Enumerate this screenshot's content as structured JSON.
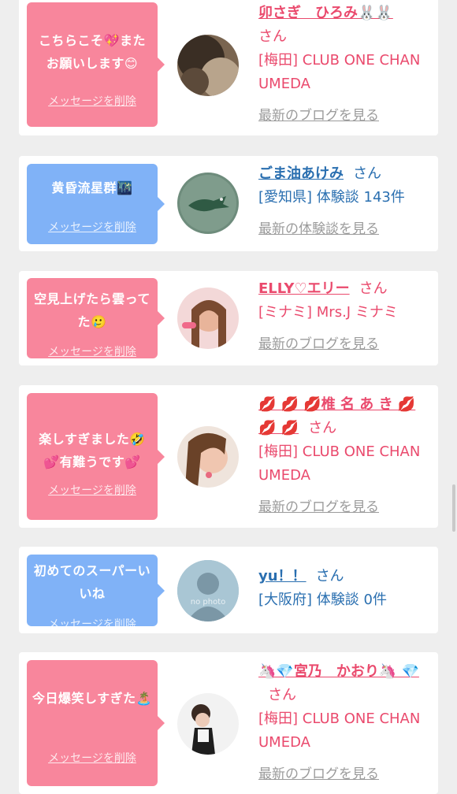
{
  "delete_label": "メッセージを削除",
  "san_label": "さん",
  "items": [
    {
      "message": "こちらこそ💖また お願いします😊",
      "name": "卯さぎ　ひろみ🐰🐰",
      "shop": "[梅田] CLUB ONE CHAN UMEDA",
      "link": "最新のブログを見る"
    },
    {
      "message": "黄昏流星群🌃",
      "name": "ごま油あけみ",
      "shop": "[愛知県] 体験談 143件",
      "link": "最新の体験談を見る"
    },
    {
      "message": "空見上げたら雲ってた🥲",
      "name": "ELLY♡エリー",
      "shop": "[ミナミ] Mrs.J ミナミ",
      "link": "最新のブログを見る"
    },
    {
      "message": "楽しすぎました🤣 💕有難うです💕",
      "name": "💋 💋 💋椎 名 あ き 💋 💋 💋",
      "shop": "[梅田] CLUB ONE CHAN UMEDA",
      "link": "最新のブログを見る"
    },
    {
      "message": "初めてのスーパーいいね",
      "name": "yu！！",
      "shop": "[大阪府] 体験談 0件",
      "link": "",
      "avatar_text": "no photo"
    },
    {
      "message": "今日爆笑しすぎた🏝️",
      "name": "🦄💎宮乃　かおり🦄 💎",
      "shop": "[梅田] CLUB ONE CHAN UMEDA",
      "link": "最新のブログを見る"
    }
  ]
}
